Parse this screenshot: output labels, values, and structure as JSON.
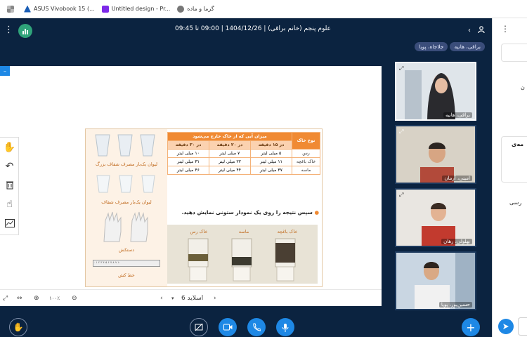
{
  "browser": {
    "bookmarks": [
      {
        "label": "ASUS Vivobook 15 (...",
        "icon": "asus-logo-icon"
      },
      {
        "label": "Untitled design - Pr...",
        "icon": "canva-icon"
      },
      {
        "label": "گرما و ماده",
        "icon": "globe-icon"
      }
    ]
  },
  "meeting": {
    "title": "علوم پنجم (خانم براقی) | 1404/12/26 | 09:00 تا 09:45",
    "chips": [
      "براقی، هانیه",
      "جلاجاه، پویا"
    ]
  },
  "slide": {
    "table_header": "میزان آبی که از خاک خارج می‌شود",
    "col_soil_type": "نوع خاک",
    "cols": [
      "در ۱۵ دقیقه",
      "در ۲۰ دقیقه",
      "در ۳۰ دقیقه"
    ],
    "rows": [
      {
        "soil": "رس",
        "values": [
          "۵ میلی لیتر",
          "۷ میلی لیتر",
          "۱۰ میلی لیتر"
        ]
      },
      {
        "soil": "خاک باغچه",
        "values": [
          "۱۱ میلی لیتر",
          "۲۲ میلی لیتر",
          "۳۱ میلی لیتر"
        ]
      },
      {
        "soil": "ماسه",
        "values": [
          "۳۷ میلی لیتر",
          "۴۴ میلی لیتر",
          "۴۶ میلی لیتر"
        ]
      }
    ],
    "instruction": "سپس نتیجه را روی یک نمودار ستونی نمایش دهید.",
    "photo_labels": [
      "خاک رس",
      "ماسه",
      "خاک باغچه"
    ],
    "materials": [
      "لیوان یک‌بار مصرف شفاف بزرگ",
      "لیوان یک‌بار مصرف شفاف",
      "دستکش",
      "خط کش"
    ],
    "ruler_marks": "۰ ۱ ۲ ۳ ۴ ۵ ۶ ۷ ۸ ۹ ۱۰"
  },
  "navigator": {
    "slide_label": "اسلاید 6",
    "zoom": "۱۰۰٪"
  },
  "cameras": [
    {
      "name": "براقی، هانیه",
      "active": true
    },
    {
      "name": "امینی، آرمان",
      "active": false
    },
    {
      "name": "بهلولی، رهان",
      "active": false
    },
    {
      "name": "حسین‌پور، پویا",
      "active": false
    }
  ],
  "side_panel": {
    "partial_texts": [
      "ن",
      "مه‌ی",
      "رسی"
    ]
  },
  "colors": {
    "app_bg": "#0b2340",
    "accent": "#1e88e5",
    "table_orange": "#f08a33"
  }
}
